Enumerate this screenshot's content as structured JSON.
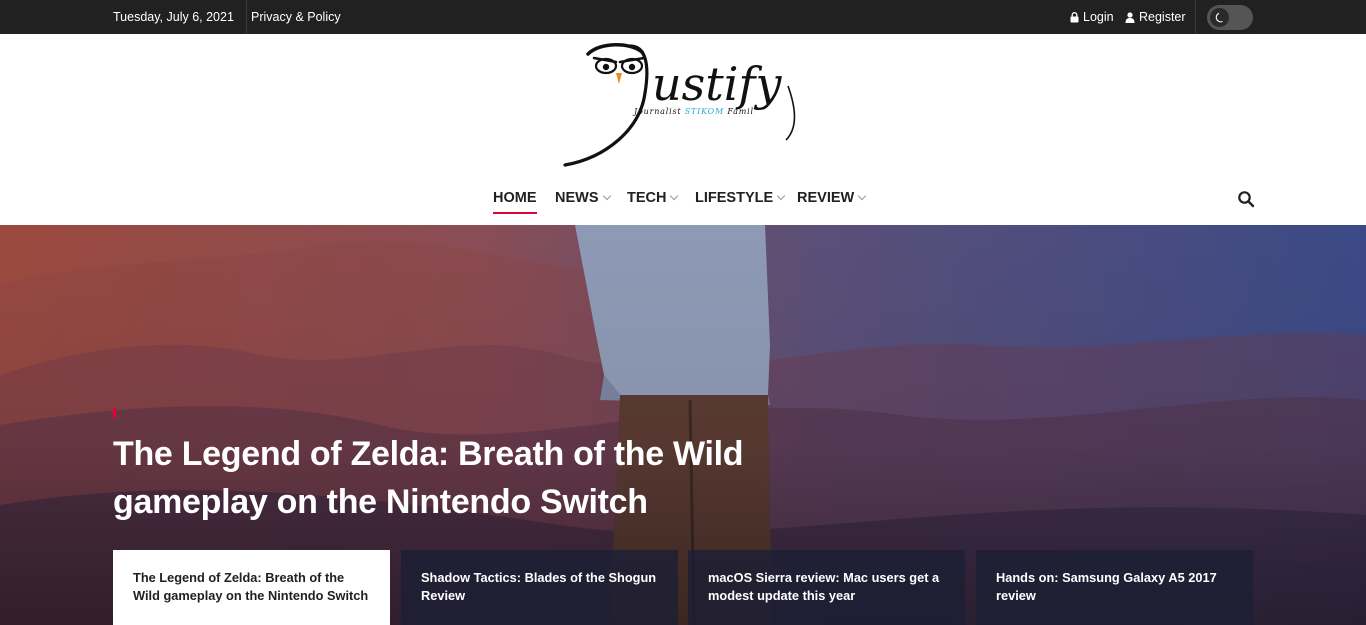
{
  "topbar": {
    "date": "Tuesday, July 6, 2021",
    "privacy_link": "Privacy & Policy",
    "login_label": "Login",
    "register_label": "Register",
    "dark_mode_toggle_icon": "moon-icon"
  },
  "logo": {
    "brand_name": "ustify",
    "tagline_left": "Journalist ",
    "tagline_accent": "STIKOM",
    "tagline_right": " Famil"
  },
  "nav": {
    "items": [
      {
        "label": "HOME",
        "active": true
      },
      {
        "label": "NEWS",
        "has_dropdown": true
      },
      {
        "label": "TECH",
        "has_dropdown": true
      },
      {
        "label": "LIFESTYLE",
        "has_dropdown": true
      },
      {
        "label": "REVIEW",
        "has_dropdown": true
      }
    ],
    "search_icon": "search-icon"
  },
  "hero": {
    "title": "The Legend of Zelda: Breath of the Wild gameplay on the Nintendo Switch",
    "cards": [
      {
        "title": "The Legend of Zelda: Breath of the Wild gameplay on the Nintendo Switch",
        "active": true
      },
      {
        "title": "Shadow Tactics: Blades of the Shogun Review"
      },
      {
        "title": "macOS Sierra review: Mac users get a modest update this year"
      },
      {
        "title": "Hands on: Samsung Galaxy A5 2017 review"
      }
    ]
  },
  "colors": {
    "accent": "#e4003a",
    "topbar_bg": "#212121",
    "card_dark": "#1c1e34",
    "logo_tagline_accent": "#29a8e0"
  }
}
